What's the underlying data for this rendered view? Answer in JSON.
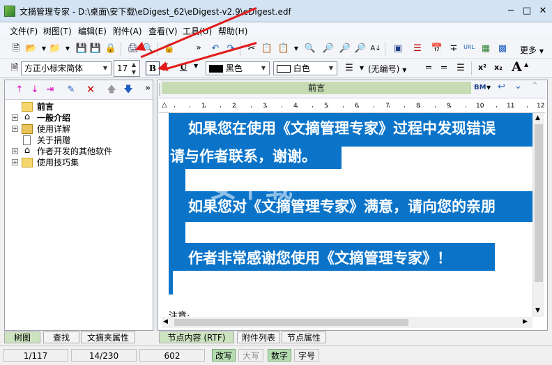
{
  "window": {
    "title": "文摘管理专家 - D:\\桌面\\安下载\\eDigest_62\\eDigest-v2.9\\eDigest.edf",
    "controls": [
      "minimize-icon",
      "maximize-icon",
      "close-icon"
    ]
  },
  "menu": {
    "items": [
      "文件(F)",
      "树图(T)",
      "编辑(E)",
      "附件(A)",
      "查看(V)",
      "工具(U)",
      "帮助(H)"
    ]
  },
  "toolbar": {
    "more_label": "更多",
    "overflow": "»"
  },
  "format_toolbar": {
    "font_name": "方正小标宋简体",
    "font_size": "17",
    "bold_label": "B",
    "italic_label": "I",
    "underline_label": "U",
    "fore_color_label": "黑色",
    "back_color_label": "白色",
    "numbering_label": "(无编号)",
    "superscript_label": "x²",
    "subscript_label": "x₂",
    "font_size_label": "A"
  },
  "tree": {
    "toolbar_overflow": "»",
    "items": [
      {
        "label": "前言",
        "bold": true,
        "expander": "",
        "icon": "folder-icon"
      },
      {
        "label": "一般介绍",
        "bold": true,
        "expander": "+",
        "icon": "home-icon"
      },
      {
        "label": "使用详解",
        "bold": false,
        "expander": "+",
        "icon": "open-folder-icon"
      },
      {
        "label": "关于捐赠",
        "bold": false,
        "expander": "",
        "icon": "document-icon"
      },
      {
        "label": "作者开发的其他软件",
        "bold": false,
        "expander": "+",
        "icon": "home-icon"
      },
      {
        "label": "使用技巧集",
        "bold": false,
        "expander": "+",
        "icon": "folder-icon"
      }
    ]
  },
  "left_tabs": [
    "树图",
    "查找",
    "文摘夹属性"
  ],
  "node_header": {
    "title": "前言",
    "bm_label": "BM"
  },
  "ruler": {
    "marks": [
      "1",
      "2",
      "3",
      "4",
      "5",
      "6",
      "7",
      "8",
      "9",
      "10",
      "11",
      "12"
    ]
  },
  "document": {
    "lines": [
      "如果您在使用《文摘管理专家》过程中发现错误",
      "请与作者联系，谢谢。",
      "如果您对《文摘管理专家》满意，请向您的亲朋",
      "作者非常感谢您使用《文摘管理专家》！"
    ],
    "footer_text": "注意:",
    "highlight_color": "#0b74c9"
  },
  "right_tabs": [
    "节点内容 (RTF)",
    "附件列表",
    "节点属性"
  ],
  "status": {
    "node_index": "1/117",
    "position": "14/230",
    "count": "602",
    "mode_rewrite": "改写",
    "mode_caps": "大写",
    "mode_num": "数字",
    "mode_char": "字号"
  },
  "watermark": "安下载",
  "colors": {
    "accent": "#0b74c9",
    "header_green": "#c8dcb4",
    "annotation_red": "#e31b1b"
  }
}
